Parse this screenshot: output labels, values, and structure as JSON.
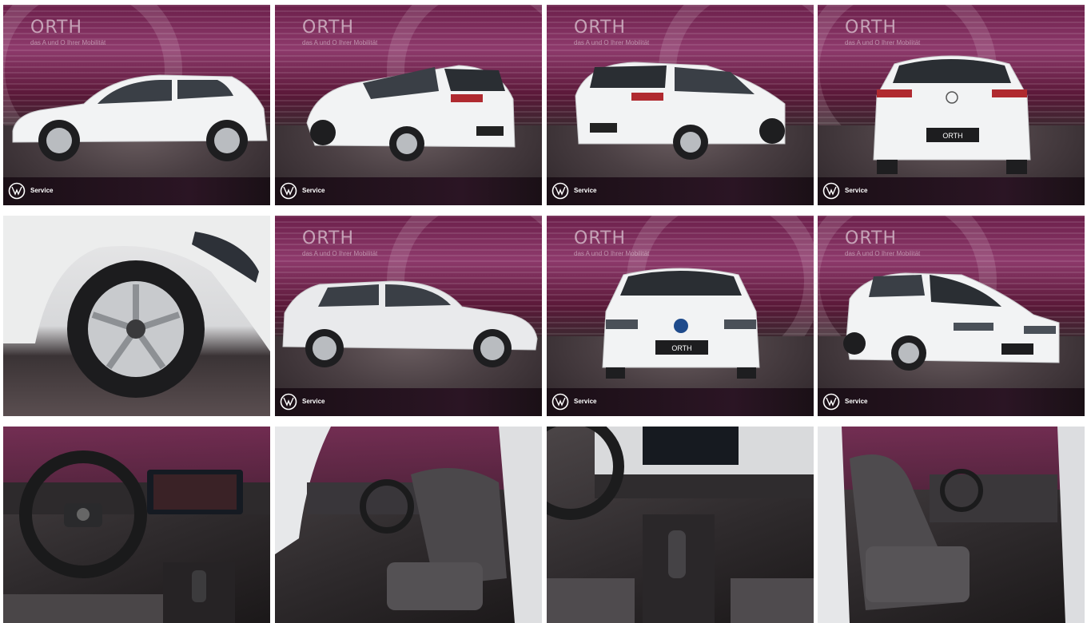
{
  "gallery": {
    "dealer": {
      "name": "ORTH",
      "tagline": "das A und O Ihrer Mobilität"
    },
    "banner_label": "Service",
    "plate_text": "ORTH",
    "brand_icon": "vw-logo-icon",
    "colors": {
      "studio_magenta": "#8e3a6c",
      "banner_dark": "#2b1524",
      "car_white": "#f2f3f4",
      "interior_grey": "#3a3536"
    },
    "photos": [
      {
        "view": "side-left"
      },
      {
        "view": "rear-left"
      },
      {
        "view": "rear-right"
      },
      {
        "view": "rear"
      },
      {
        "view": "wheel-detail"
      },
      {
        "view": "side-right"
      },
      {
        "view": "front"
      },
      {
        "view": "front-right"
      },
      {
        "view": "cockpit"
      },
      {
        "view": "front-seats"
      },
      {
        "view": "center-console"
      },
      {
        "view": "passenger-seat"
      }
    ]
  }
}
